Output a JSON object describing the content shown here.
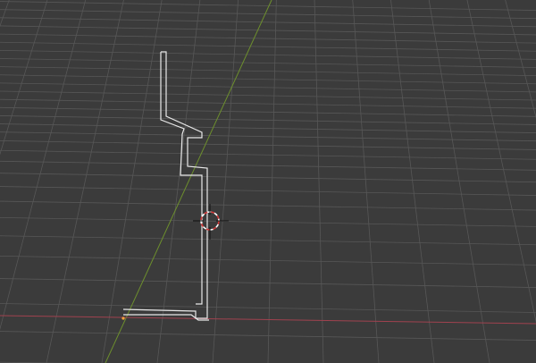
{
  "viewport": {
    "background": "#3b3b3b",
    "grid_color": "#575757",
    "x_axis_color": "#a0424f",
    "y_axis_color": "#6d8f2d"
  },
  "outline": {
    "stroke_color": "#e8e8e8",
    "selected_vertex_color": "#ffa23a"
  },
  "cursor_3d": {
    "ring_color_a": "#d23a3a",
    "ring_color_b": "#ffffff",
    "crosshair_color": "#111111"
  }
}
